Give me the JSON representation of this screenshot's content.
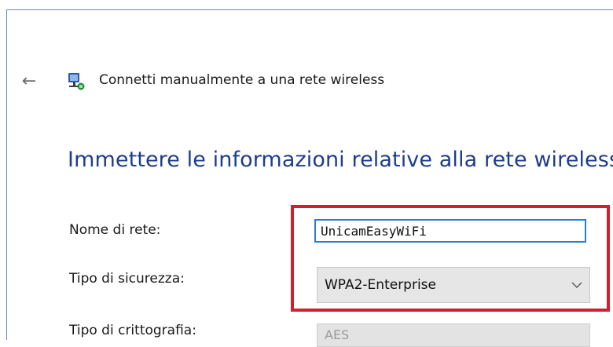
{
  "window": {
    "title": "Connetti manualmente a una rete wireless"
  },
  "page": {
    "heading": "Immettere le informazioni relative alla rete wireless"
  },
  "form": {
    "network_name_label": "Nome di rete:",
    "network_name_value": "UnicamEasyWiFi",
    "security_type_label": "Tipo di sicurezza:",
    "security_type_value": "WPA2-Enterprise",
    "encryption_type_label": "Tipo di crittografia:",
    "encryption_type_value": "AES"
  },
  "colors": {
    "heading": "#1e3e8a",
    "highlight": "#d01f2e",
    "input_focus_border": "#2a7ad3"
  },
  "icons": {
    "back": "arrow-left-icon",
    "network": "network-icon",
    "dropdown": "chevron-down-icon"
  }
}
